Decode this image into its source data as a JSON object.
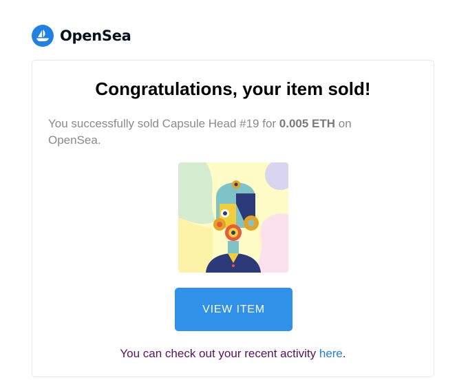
{
  "brand": {
    "name": "OpenSea",
    "logo_icon": "opensea-ship-icon",
    "color": "#2081e2"
  },
  "card": {
    "headline": "Congratulations, your item sold!",
    "message_prefix": "You successfully sold Capsule Head #19 for ",
    "price": "0.005 ETH",
    "message_suffix": " on OpenSea.",
    "image_icon": "nft-artwork-capsule-head",
    "button_label": "VIEW ITEM",
    "button_color": "#2f91e8",
    "activity_prefix": "You can check out your recent activity ",
    "activity_link": "here",
    "activity_suffix": "."
  }
}
